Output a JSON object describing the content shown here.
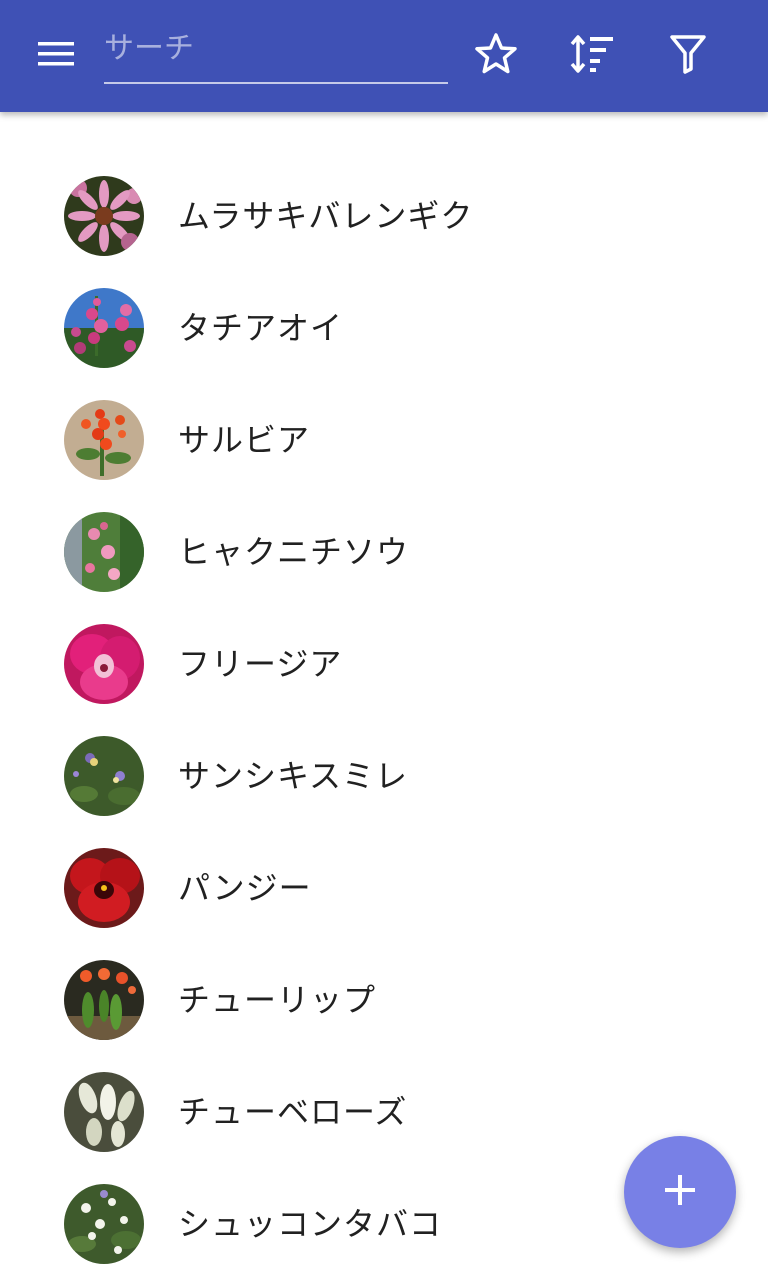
{
  "appbar": {
    "color": "#3F51B5",
    "menu_icon": "menu-icon",
    "search": {
      "placeholder": "サーチ",
      "value": ""
    },
    "actions": [
      "star-icon",
      "sort-icon",
      "filter-icon"
    ]
  },
  "flowers": [
    {
      "name": "ムラサキバレンギク",
      "thumb": "purple-coneflower-photo"
    },
    {
      "name": "タチアオイ",
      "thumb": "hollyhock-photo"
    },
    {
      "name": "サルビア",
      "thumb": "salvia-photo"
    },
    {
      "name": "ヒャクニチソウ",
      "thumb": "zinnia-photo"
    },
    {
      "name": "フリージア",
      "thumb": "freesia-photo"
    },
    {
      "name": "サンシキスミレ",
      "thumb": "wild-pansy-photo"
    },
    {
      "name": "パンジー",
      "thumb": "pansy-photo"
    },
    {
      "name": "チューリップ",
      "thumb": "tulip-photo"
    },
    {
      "name": "チューベローズ",
      "thumb": "tuberose-photo"
    },
    {
      "name": "シュッコンタバコ",
      "thumb": "flowering-tobacco-photo"
    }
  ],
  "fab": {
    "icon": "plus-icon",
    "color": "#7880e6"
  }
}
